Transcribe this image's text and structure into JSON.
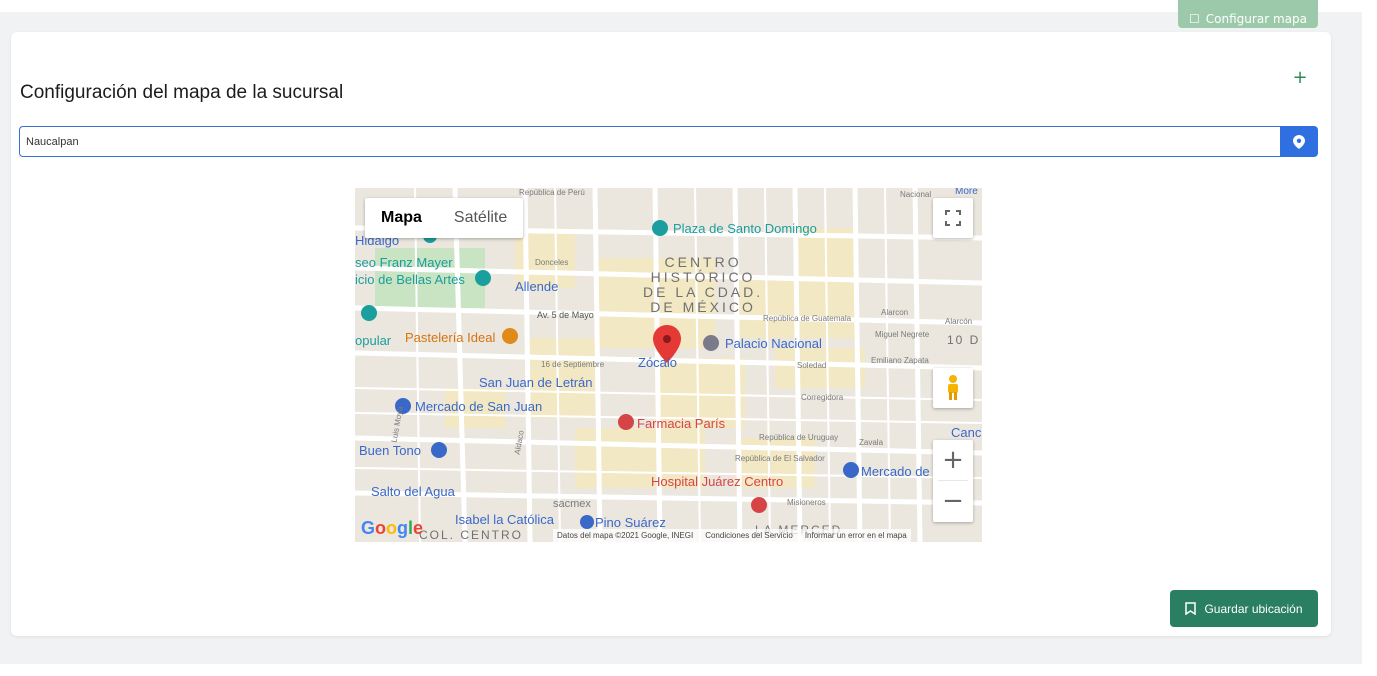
{
  "header": {
    "top_button_label": "Configurar mapa"
  },
  "card": {
    "title": "Configuración del mapa de la sucursal",
    "add_icon": "plus-icon"
  },
  "search": {
    "value": "Naucalpan",
    "button_icon": "map-pin-icon"
  },
  "map": {
    "type_options": [
      "Mapa",
      "Satélite"
    ],
    "selected_type": "Mapa",
    "district_label": "CENTRO\nHISTÓRICO\nDE LA CDAD.\nDE MÉXICO",
    "places": {
      "plaza": "Plaza de Santo Domingo",
      "franz": "seo Franz Mayer",
      "bellas": "icio de Bellas Artes",
      "hidalgo": "Hidalgo",
      "allende": "Allende",
      "pasteleria": "Pastelería Ideal",
      "palacio": "Palacio Nacional",
      "zocalo": "Zócalo",
      "popular": "opular",
      "sanjuanletran": "San Juan de Letrán",
      "mercadosj": "Mercado de San Juan",
      "farmacia": "Farmacia París",
      "buentono": "Buen Tono",
      "hospital": "Hospital Juárez Centro",
      "saltoagua": "Salto del Agua",
      "sacmex": "sacmex",
      "isabel": "Isabel la Católica",
      "pino": "Pino Suárez",
      "mercadod": "Mercado de",
      "cand": "Canc",
      "diez": "10 D",
      "merced": "LA MERCED",
      "colcentro": "COL. CENTRO",
      "nacional": "Nacional",
      "more": "More"
    },
    "streets": {
      "av5mayo": "Av. 5 de Mayo",
      "16sept": "16 de Septiembre",
      "donceles": "Donceles",
      "republicaperu": "República de Perú",
      "republicaguatemala": "República de Guatemala",
      "republicauruguay": "República de Uruguay",
      "republicasalvador": "República de El Salvador",
      "soledad": "Soledad",
      "corregidora": "Corregidora",
      "zavala": "Zavala",
      "misioneros": "Misioneros",
      "alarcon": "Alarcon",
      "alarcon2": "Alarcón",
      "emiliano": "Emiliano Zapata",
      "miguelnegrete": "Miguel Negrete",
      "luismoya": "Luis Moya",
      "aldaco": "Aldaco"
    },
    "attribution": [
      "Datos del mapa ©2021 Google, INEGI",
      "Condiciones del Servicio",
      "Informar un error en el mapa"
    ],
    "logo": "Google"
  },
  "footer": {
    "save_label": "Guardar ubicación"
  },
  "colors": {
    "accent_green": "#2a7f62",
    "input_blue": "#2f6fe0",
    "pin_red": "#e53935"
  }
}
